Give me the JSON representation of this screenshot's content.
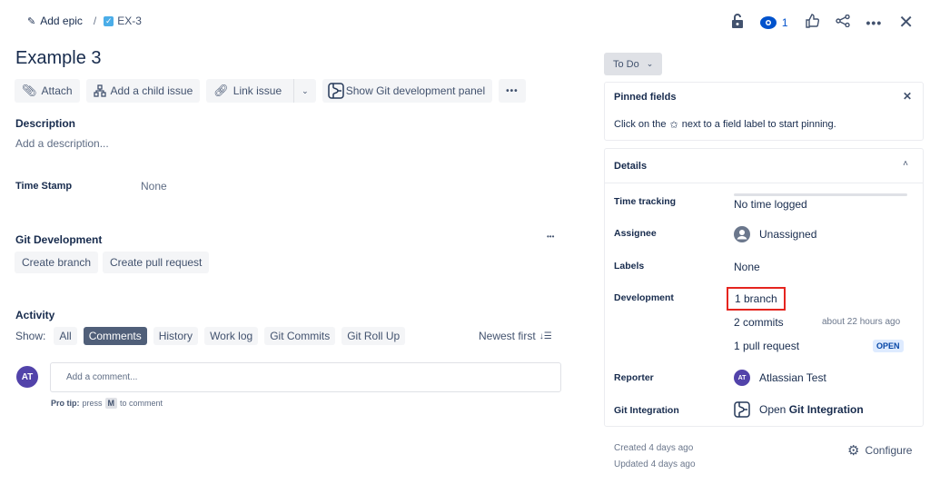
{
  "breadcrumb": {
    "add_epic": "Add epic",
    "separator": "/",
    "issue_key": "EX-3"
  },
  "issue": {
    "title": "Example 3"
  },
  "toolbar": {
    "attach": "Attach",
    "add_child": "Add a child issue",
    "link_issue": "Link issue",
    "git_panel": "Show Git development panel",
    "more": "•••"
  },
  "header_actions": {
    "watch_count": "1"
  },
  "description": {
    "label": "Description",
    "placeholder": "Add a description..."
  },
  "time_stamp": {
    "label": "Time Stamp",
    "value": "None"
  },
  "git_development": {
    "label": "Git Development",
    "more": "•••",
    "create_branch": "Create branch",
    "create_pr": "Create pull request"
  },
  "activity": {
    "label": "Activity",
    "show_label": "Show:",
    "tabs": [
      "All",
      "Comments",
      "History",
      "Work log",
      "Git Commits",
      "Git Roll Up"
    ],
    "active_tab": "Comments",
    "sort": "Newest first",
    "comment_placeholder": "Add a comment...",
    "avatar_initials": "AT",
    "pro_tip_label": "Pro tip:",
    "pro_tip_pre": "press",
    "pro_tip_key": "M",
    "pro_tip_post": "to comment"
  },
  "status": {
    "label": "To Do"
  },
  "pinned": {
    "title": "Pinned fields",
    "hint_pre": "Click on the",
    "hint_post": "next to a field label to start pinning."
  },
  "details": {
    "title": "Details",
    "time_tracking": {
      "label": "Time tracking",
      "value": "No time logged"
    },
    "assignee": {
      "label": "Assignee",
      "value": "Unassigned"
    },
    "labels": {
      "label": "Labels",
      "value": "None"
    },
    "development": {
      "label": "Development",
      "branch": "1 branch",
      "commits": "2 commits",
      "commits_time": "about 22 hours ago",
      "pull_request": "1 pull request",
      "pr_status": "OPEN"
    },
    "reporter": {
      "label": "Reporter",
      "value": "Atlassian Test",
      "initials": "AT"
    },
    "git_integration": {
      "label": "Git Integration",
      "open": "Open",
      "name": "Git Integration"
    }
  },
  "footer": {
    "created": "Created 4 days ago",
    "updated": "Updated 4 days ago",
    "configure": "Configure"
  },
  "colors": {
    "accent": "#0052cc",
    "avatar": "#5243aa",
    "highlight": "#e5251f"
  }
}
